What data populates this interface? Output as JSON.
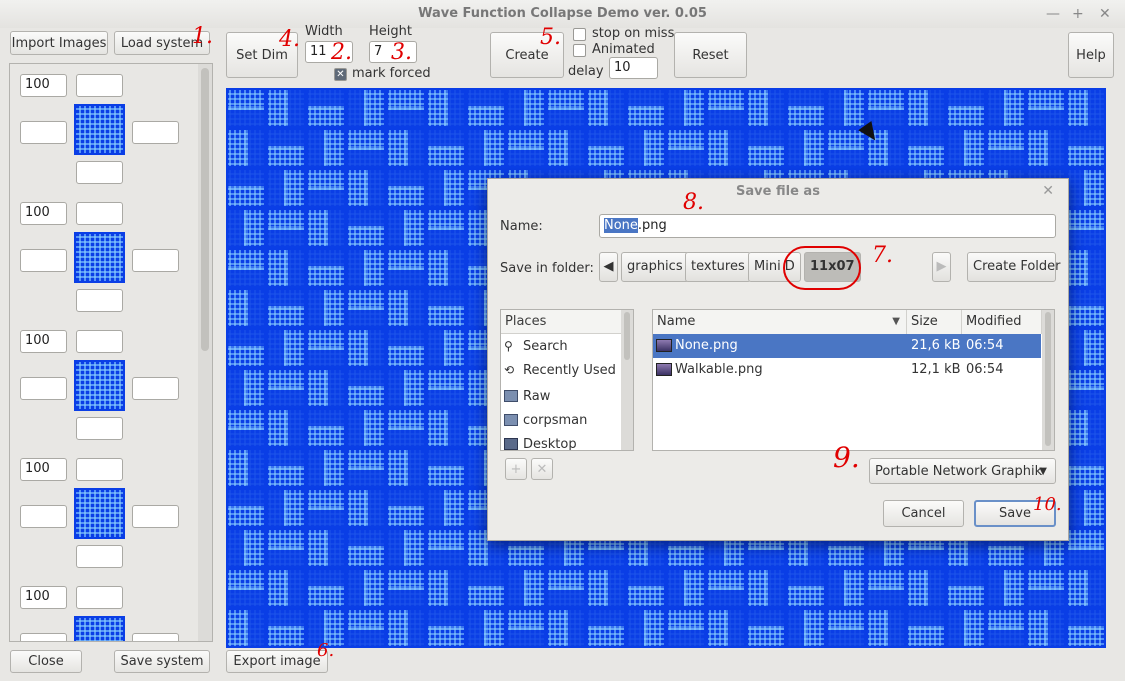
{
  "window": {
    "title": "Wave Function Collapse Demo ver. 0.05",
    "controls": [
      "—",
      "+",
      "✕"
    ]
  },
  "toolbar": {
    "import_images": "Import Images",
    "load_system": "Load system",
    "set_dim": "Set Dim",
    "width_label": "Width",
    "width_value": "11",
    "height_label": "Height",
    "height_value": "7",
    "mark_forced": "mark forced",
    "create": "Create",
    "stop_on_miss": "stop on miss",
    "animated": "Animated",
    "delay_label": "delay",
    "delay_value": "10",
    "reset": "Reset",
    "help": "Help"
  },
  "left_panel": {
    "weights": [
      "100",
      "100",
      "100",
      "100",
      "100"
    ]
  },
  "bottom": {
    "close": "Close",
    "save_system": "Save system",
    "export_image": "Export image"
  },
  "annotations": [
    "1.",
    "2.",
    "3.",
    "4.",
    "5.",
    "6.",
    "7.",
    "8.",
    "9.",
    "10."
  ],
  "dialog": {
    "title": "Save file as",
    "name_label": "Name:",
    "name_selected": "None",
    "name_rest": ".png",
    "folder_label": "Save in folder:",
    "breadcrumbs": [
      "graphics",
      "textures",
      "Mini D",
      "11x07"
    ],
    "create_folder": "Create Folder",
    "places_header": "Places",
    "places": [
      "Search",
      "Recently Used",
      "Raw",
      "corpsman",
      "Desktop"
    ],
    "columns": {
      "name": "Name",
      "size": "Size",
      "modified": "Modified"
    },
    "files": [
      {
        "name": "None.png",
        "size": "21,6 kB",
        "modified": "06:54"
      },
      {
        "name": "Walkable.png",
        "size": "12,1 kB",
        "modified": "06:54"
      }
    ],
    "filter": "Portable Network Graphik",
    "cancel": "Cancel",
    "save": "Save"
  },
  "colors": {
    "tile_dark": "#0a3ee6",
    "tile_light": "#8cd2ff",
    "selection": "#4a76c4",
    "annotation": "#e00000"
  }
}
